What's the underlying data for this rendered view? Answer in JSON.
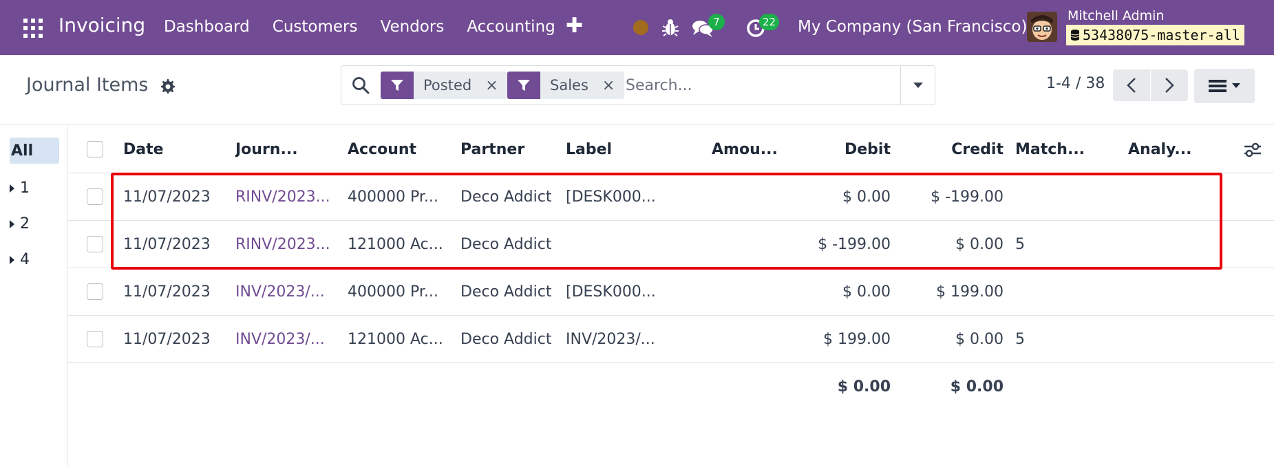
{
  "navbar": {
    "app_title": "Invoicing",
    "menu": [
      "Dashboard",
      "Customers",
      "Vendors",
      "Accounting"
    ],
    "plus": "✚",
    "messages_count": "7",
    "activities_count": "22",
    "company": "My Company (San Francisco)",
    "user_name": "Mitchell Admin",
    "database": "53438075-master-all",
    "colors": {
      "navbar": "#714b93",
      "badge": "#1bb04a",
      "status_dot": "#a26b1d"
    }
  },
  "control_panel": {
    "title": "Journal Items",
    "facets": [
      {
        "label": "Posted",
        "close": "×"
      },
      {
        "label": "Sales",
        "close": "×"
      }
    ],
    "search_placeholder": "Search...",
    "pager": "1-4 / 38"
  },
  "sidebar": {
    "items": [
      {
        "label": "All"
      },
      {
        "label": "1"
      },
      {
        "label": "2"
      },
      {
        "label": "4"
      }
    ]
  },
  "table": {
    "columns": [
      "Date",
      "Journ...",
      "Account",
      "Partner",
      "Label",
      "Amou...",
      "Debit",
      "Credit",
      "Match...",
      "Analy..."
    ],
    "rows": [
      {
        "date": "11/07/2023",
        "journal": "RINV/2023...",
        "account": "400000 Pr...",
        "partner": "Deco Addict",
        "label": "[DESK000...",
        "amount": "",
        "debit": "$ 0.00",
        "credit": "$ -199.00",
        "matching": "",
        "analytic": ""
      },
      {
        "date": "11/07/2023",
        "journal": "RINV/2023...",
        "account": "121000 Ac...",
        "partner": "Deco Addict",
        "label": "",
        "amount": "",
        "debit": "$ -199.00",
        "credit": "$ 0.00",
        "matching": "5",
        "analytic": ""
      },
      {
        "date": "11/07/2023",
        "journal": "INV/2023/...",
        "account": "400000 Pr...",
        "partner": "Deco Addict",
        "label": "[DESK000...",
        "amount": "",
        "debit": "$ 0.00",
        "credit": "$ 199.00",
        "matching": "",
        "analytic": ""
      },
      {
        "date": "11/07/2023",
        "journal": "INV/2023/...",
        "account": "121000 Ac...",
        "partner": "Deco Addict",
        "label": "INV/2023/...",
        "amount": "",
        "debit": "$ 199.00",
        "credit": "$ 0.00",
        "matching": "5",
        "analytic": ""
      }
    ],
    "totals": {
      "debit": "$ 0.00",
      "credit": "$ 0.00"
    }
  }
}
